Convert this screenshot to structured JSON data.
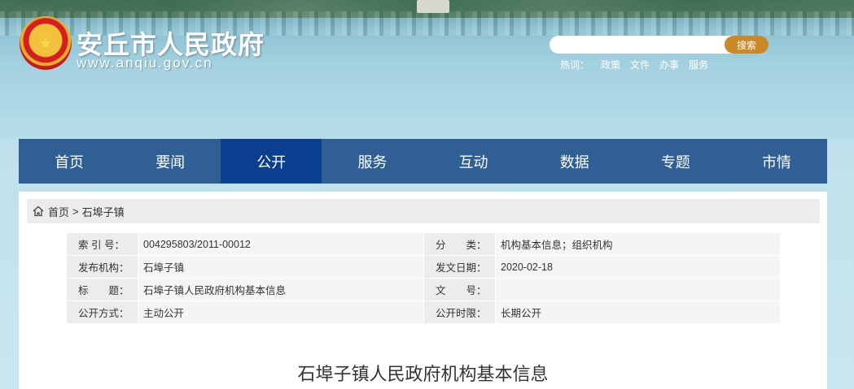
{
  "header": {
    "site_name": "安丘市人民政府",
    "site_url": "www.anqiu.gov.cn",
    "emblem": "national-emblem-icon"
  },
  "search": {
    "placeholder": "",
    "button_label": "搜索"
  },
  "hot_words": {
    "label": "热词：",
    "items": [
      "政策",
      "文件",
      "办事",
      "服务"
    ]
  },
  "nav": {
    "items": [
      "首页",
      "要闻",
      "公开",
      "服务",
      "互动",
      "数据",
      "专题",
      "市情"
    ],
    "active": "公开"
  },
  "breadcrumb": {
    "home": "首页",
    "separator": ">",
    "current": "石埠子镇"
  },
  "meta": {
    "rows": [
      {
        "k1": "索 引 号：",
        "v1": "004295803/2011-00012",
        "k2": "分　　类：",
        "v2": "机构基本信息；组织机构"
      },
      {
        "k1": "发布机构：",
        "v1": "石埠子镇",
        "k2": "发文日期：",
        "v2": "2020-02-18"
      },
      {
        "k1": "标　　题：",
        "v1": "石埠子镇人民政府机构基本信息",
        "k2": "文　　号：",
        "v2": ""
      },
      {
        "k1": "公开方式：",
        "v1": "主动公开",
        "k2": "公开时限：",
        "v2": "长期公开"
      }
    ]
  },
  "article": {
    "title": "石埠子镇人民政府机构基本信息"
  },
  "colors": {
    "nav_bg": "#2f5f95",
    "nav_active": "#0b3f8f",
    "search_button": "#c9882a"
  }
}
